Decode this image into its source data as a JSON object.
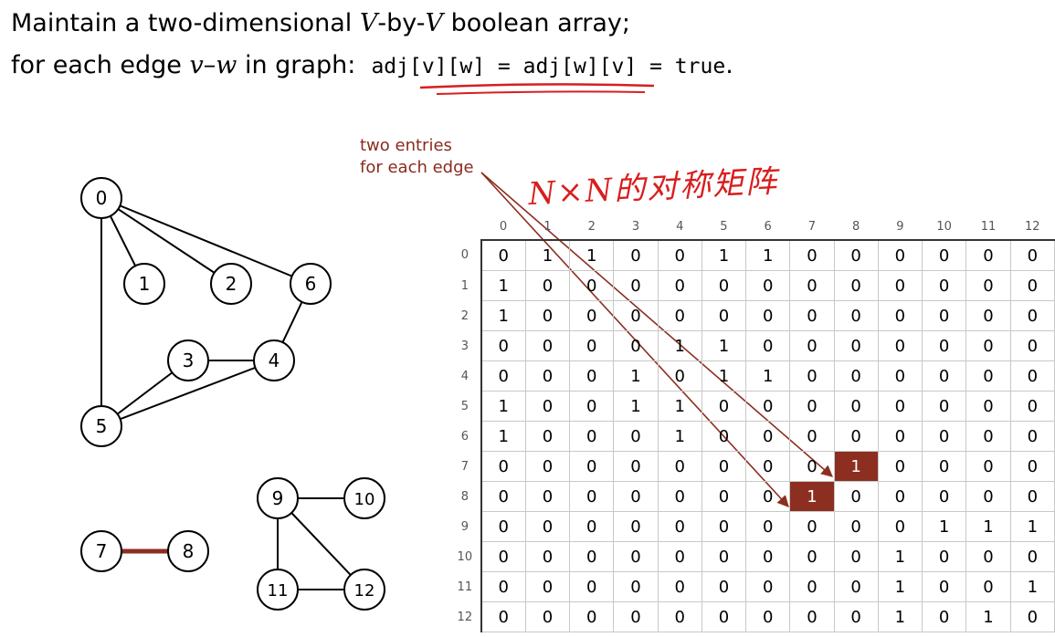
{
  "heading": {
    "line1_part1": "Maintain a two-dimensional ",
    "line1_var1": "V",
    "line1_part2": "-by-",
    "line1_var2": "V",
    "line1_part3": " boolean array;",
    "line2_part1": "for each edge ",
    "line2_var": "v–w",
    "line2_part2": " in graph:  ",
    "line2_code": "adj[v][w] = adj[w][v] = true",
    "line2_end": "."
  },
  "annotation": {
    "line1": "two entries",
    "line2": "for each edge"
  },
  "handwriting": "N×N的对称矩阵",
  "colors": {
    "accent": "#8c2f20",
    "handwriting": "#d81e1e"
  },
  "graph": {
    "vertices": [
      "0",
      "1",
      "2",
      "3",
      "4",
      "5",
      "6",
      "7",
      "8",
      "9",
      "10",
      "11",
      "12"
    ],
    "edges": [
      [
        0,
        1
      ],
      [
        0,
        2
      ],
      [
        0,
        6
      ],
      [
        0,
        5
      ],
      [
        6,
        4
      ],
      [
        3,
        4
      ],
      [
        4,
        5
      ],
      [
        3,
        5
      ],
      [
        7,
        8
      ],
      [
        9,
        10
      ],
      [
        9,
        11
      ],
      [
        9,
        12
      ],
      [
        11,
        12
      ]
    ],
    "highlighted_edge": [
      7,
      8
    ]
  },
  "matrix": {
    "col_headers": [
      "0",
      "1",
      "2",
      "3",
      "4",
      "5",
      "6",
      "7",
      "8",
      "9",
      "10",
      "11",
      "12"
    ],
    "row_headers": [
      "0",
      "1",
      "2",
      "3",
      "4",
      "5",
      "6",
      "7",
      "8",
      "9",
      "10",
      "11",
      "12"
    ],
    "cells": [
      [
        "0",
        "1",
        "1",
        "0",
        "0",
        "1",
        "1",
        "0",
        "0",
        "0",
        "0",
        "0",
        "0"
      ],
      [
        "1",
        "0",
        "0",
        "0",
        "0",
        "0",
        "0",
        "0",
        "0",
        "0",
        "0",
        "0",
        "0"
      ],
      [
        "1",
        "0",
        "0",
        "0",
        "0",
        "0",
        "0",
        "0",
        "0",
        "0",
        "0",
        "0",
        "0"
      ],
      [
        "0",
        "0",
        "0",
        "0",
        "1",
        "1",
        "0",
        "0",
        "0",
        "0",
        "0",
        "0",
        "0"
      ],
      [
        "0",
        "0",
        "0",
        "1",
        "0",
        "1",
        "1",
        "0",
        "0",
        "0",
        "0",
        "0",
        "0"
      ],
      [
        "1",
        "0",
        "0",
        "1",
        "1",
        "0",
        "0",
        "0",
        "0",
        "0",
        "0",
        "0",
        "0"
      ],
      [
        "1",
        "0",
        "0",
        "0",
        "1",
        "0",
        "0",
        "0",
        "0",
        "0",
        "0",
        "0",
        "0"
      ],
      [
        "0",
        "0",
        "0",
        "0",
        "0",
        "0",
        "0",
        "0",
        "1",
        "0",
        "0",
        "0",
        "0"
      ],
      [
        "0",
        "0",
        "0",
        "0",
        "0",
        "0",
        "0",
        "1",
        "0",
        "0",
        "0",
        "0",
        "0"
      ],
      [
        "0",
        "0",
        "0",
        "0",
        "0",
        "0",
        "0",
        "0",
        "0",
        "0",
        "1",
        "1",
        "1"
      ],
      [
        "0",
        "0",
        "0",
        "0",
        "0",
        "0",
        "0",
        "0",
        "0",
        "1",
        "0",
        "0",
        "0"
      ],
      [
        "0",
        "0",
        "0",
        "0",
        "0",
        "0",
        "0",
        "0",
        "0",
        "1",
        "0",
        "0",
        "1"
      ],
      [
        "0",
        "0",
        "0",
        "0",
        "0",
        "0",
        "0",
        "0",
        "0",
        "1",
        "0",
        "1",
        "0"
      ]
    ],
    "highlighted_cells": [
      [
        7,
        8
      ],
      [
        8,
        7
      ]
    ]
  }
}
